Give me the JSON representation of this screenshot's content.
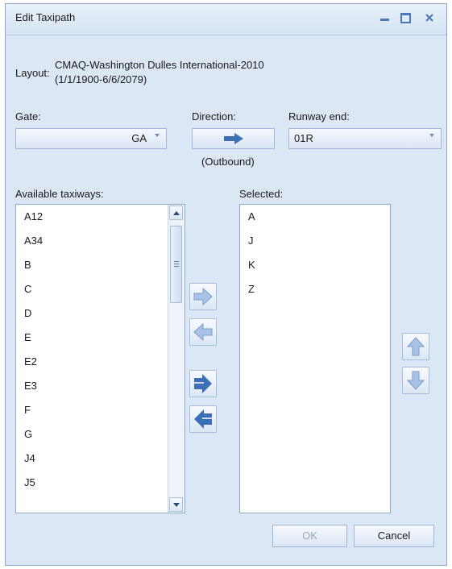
{
  "window": {
    "title": "Edit Taxipath"
  },
  "layout": {
    "label": "Layout:",
    "value_line1": "CMAQ-Washington Dulles International-2010",
    "value_line2": "(1/1/1900-6/6/2079)"
  },
  "gate": {
    "label": "Gate:",
    "value": "GA"
  },
  "direction": {
    "label": "Direction:",
    "caption": "(Outbound)"
  },
  "runway": {
    "label": "Runway end:",
    "value": "01R"
  },
  "available": {
    "label": "Available taxiways:",
    "items": [
      "A12",
      "A34",
      "B",
      "C",
      "D",
      "E",
      "E2",
      "E3",
      "F",
      "G",
      "J4",
      "J5"
    ]
  },
  "selected": {
    "label": "Selected:",
    "items": [
      "A",
      "J",
      "K",
      "Z"
    ]
  },
  "buttons": {
    "ok": "OK",
    "cancel": "Cancel"
  },
  "colors": {
    "accent": "#4a78b8",
    "window_bg": "#dbe7f5",
    "border": "#8ea8c8"
  }
}
